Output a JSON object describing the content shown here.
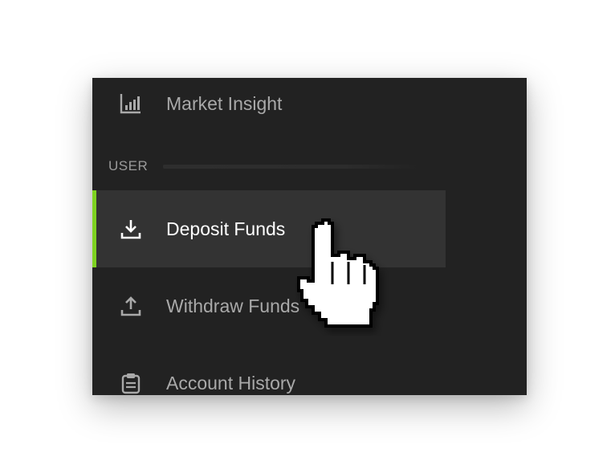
{
  "sidebar": {
    "items_top": [
      {
        "label": "Market Insight",
        "icon": "bar-chart-icon"
      }
    ],
    "section": {
      "title": "USER"
    },
    "items_user": [
      {
        "label": "Deposit Funds",
        "icon": "download-icon",
        "active": true
      },
      {
        "label": "Withdraw Funds",
        "icon": "upload-icon"
      },
      {
        "label": "Account History",
        "icon": "clipboard-icon"
      }
    ]
  },
  "colors": {
    "panel_background": "#222222",
    "active_background": "#333333",
    "accent": "#7ed321",
    "label_inactive": "#a9a9a9",
    "label_active": "#ffffff"
  },
  "cursor": {
    "icon": "hand-pointer-icon"
  }
}
